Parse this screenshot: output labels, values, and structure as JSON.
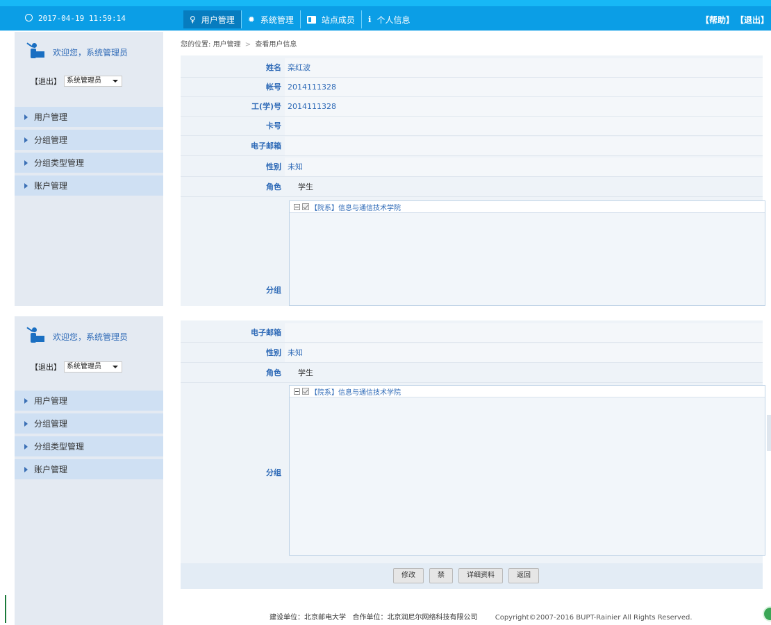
{
  "topbar": {
    "datetime": "2017-04-19    11:59:14",
    "nav": [
      {
        "label": "用户管理",
        "icon": "lightbulb-icon",
        "active": true
      },
      {
        "label": "系统管理",
        "icon": "gear-icon",
        "active": false
      },
      {
        "label": "站点成员",
        "icon": "id-card-icon",
        "active": false
      },
      {
        "label": "个人信息",
        "icon": "info-icon",
        "active": false
      }
    ],
    "help": "【帮助】",
    "logout": "【退出】"
  },
  "sidebar": {
    "welcome": "欢迎您，系统管理员",
    "logout": "【退出】",
    "role": "系统管理员",
    "menu": [
      "用户管理",
      "分组管理",
      "分组类型管理",
      "账户管理"
    ]
  },
  "breadcrumb": {
    "prefix": "您的位置:",
    "section": "用户管理",
    "separator": ">",
    "page": "查看用户信息"
  },
  "user": {
    "name_label": "姓名",
    "name": "栾红波",
    "account_label": "帐号",
    "account": "2014111328",
    "staff_label": "工(学)号",
    "staff": "2014111328",
    "card_label": "卡号",
    "card": "",
    "email_label": "电子邮箱",
    "email": "",
    "gender_label": "性别",
    "gender": "未知",
    "role_label": "角色",
    "role": "学生",
    "group_label": "分组",
    "group_tree_item": "【院系】信息与通信技术学院"
  },
  "buttons": {
    "edit": "修改",
    "ban": "禁",
    "details": "详细资料",
    "back": "返回"
  },
  "footer": {
    "builder": "建设单位：北京邮电大学",
    "partner": "合作单位：北京润尼尔网络科技有限公司",
    "copyright": "Copyright©2007-2016 BUPT-Rainier All Rights Reserved."
  },
  "colors": {
    "topbar": "#0b9ee6",
    "nav_active": "#077cbf",
    "label_blue": "#2e6ab7",
    "sidebar_bg": "#e4eaf2",
    "menu_bg": "#cfe0f3",
    "panel_bg": "#eef3f8"
  }
}
